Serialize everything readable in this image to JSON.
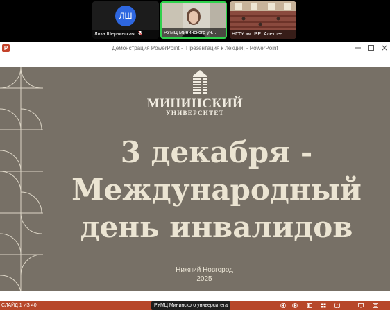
{
  "call": {
    "participants": [
      {
        "name": "Лиза Шервинская",
        "initials": "ЛШ",
        "muted": true
      },
      {
        "name": "РУМЦ Мининского ун...",
        "speaking": true
      },
      {
        "name": "НГТУ им. Р.Е. Алексее..."
      }
    ]
  },
  "window": {
    "title": "Демонстрация PowerPoint - [Презентация к лекции] - PowerPoint",
    "app_icon": "P"
  },
  "slide": {
    "logo_line1": "МИНИНСКИЙ",
    "logo_line2": "УНИВЕРСИТЕТ",
    "headline": [
      "3 декабря -",
      "Международный",
      "день инвалидов"
    ],
    "city": "Нижний Новгород",
    "year": "2025"
  },
  "statusbar": {
    "slide_counter": "СЛАЙД 1 ИЗ 40",
    "presenter": "РУМЦ Мининского университета",
    "icons": [
      "prev-icon",
      "next-icon",
      "normal-view-icon",
      "slide-sorter-icon",
      "reading-view-icon",
      "slideshow-icon",
      "notes-icon"
    ]
  },
  "colors": {
    "slide_bg": "#777066",
    "slide_text": "#ebe4d2",
    "statusbar": "#b7472a",
    "speaking_border": "#2fd14c",
    "avatar": "#2e67e0"
  }
}
